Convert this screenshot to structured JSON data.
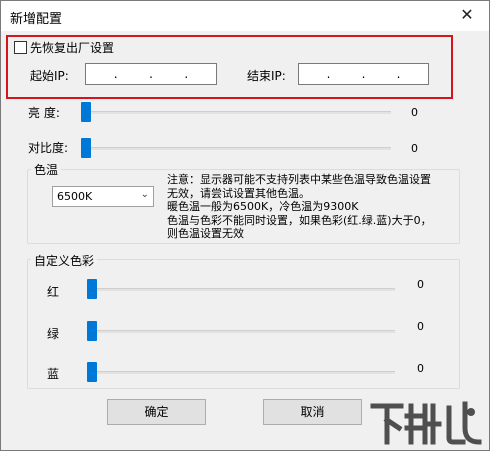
{
  "window": {
    "title": "新增配置",
    "close_glyph": "✕"
  },
  "restore": {
    "checkbox_label": "先恢复出厂设置",
    "checked": false,
    "start_ip_label": "起始IP:",
    "end_ip_label": "结束IP:",
    "start_ip_value": ". . .",
    "end_ip_value": ". . ."
  },
  "brightness": {
    "label": "亮   度:",
    "value": "0"
  },
  "contrast": {
    "label": "对比度:",
    "value": "0"
  },
  "color_temp": {
    "group_title": "色温",
    "selected": "6500K",
    "note": "注意：显示器可能不支持列表中某些色温导致色温设置\n无效，请尝试设置其他色温。\n暖色温一般为6500K，冷色温为9300K\n色温与色彩不能同时设置，如果色彩(红.绿.蓝)大于0，\n则色温设置无效"
  },
  "custom_color": {
    "group_title": "自定义色彩",
    "red_label": "红",
    "red_value": "0",
    "green_label": "绿",
    "green_value": "0",
    "blue_label": "蓝",
    "blue_value": "0"
  },
  "buttons": {
    "ok": "确定",
    "cancel": "取消"
  },
  "colors": {
    "highlight": "#d6141f",
    "slider_thumb": "#0078d7",
    "window_bg": "#f0f0f0"
  },
  "icons": {
    "close": "close-icon",
    "dropdown": "chevron-down-icon"
  },
  "watermark": {
    "text": "下载吧"
  }
}
